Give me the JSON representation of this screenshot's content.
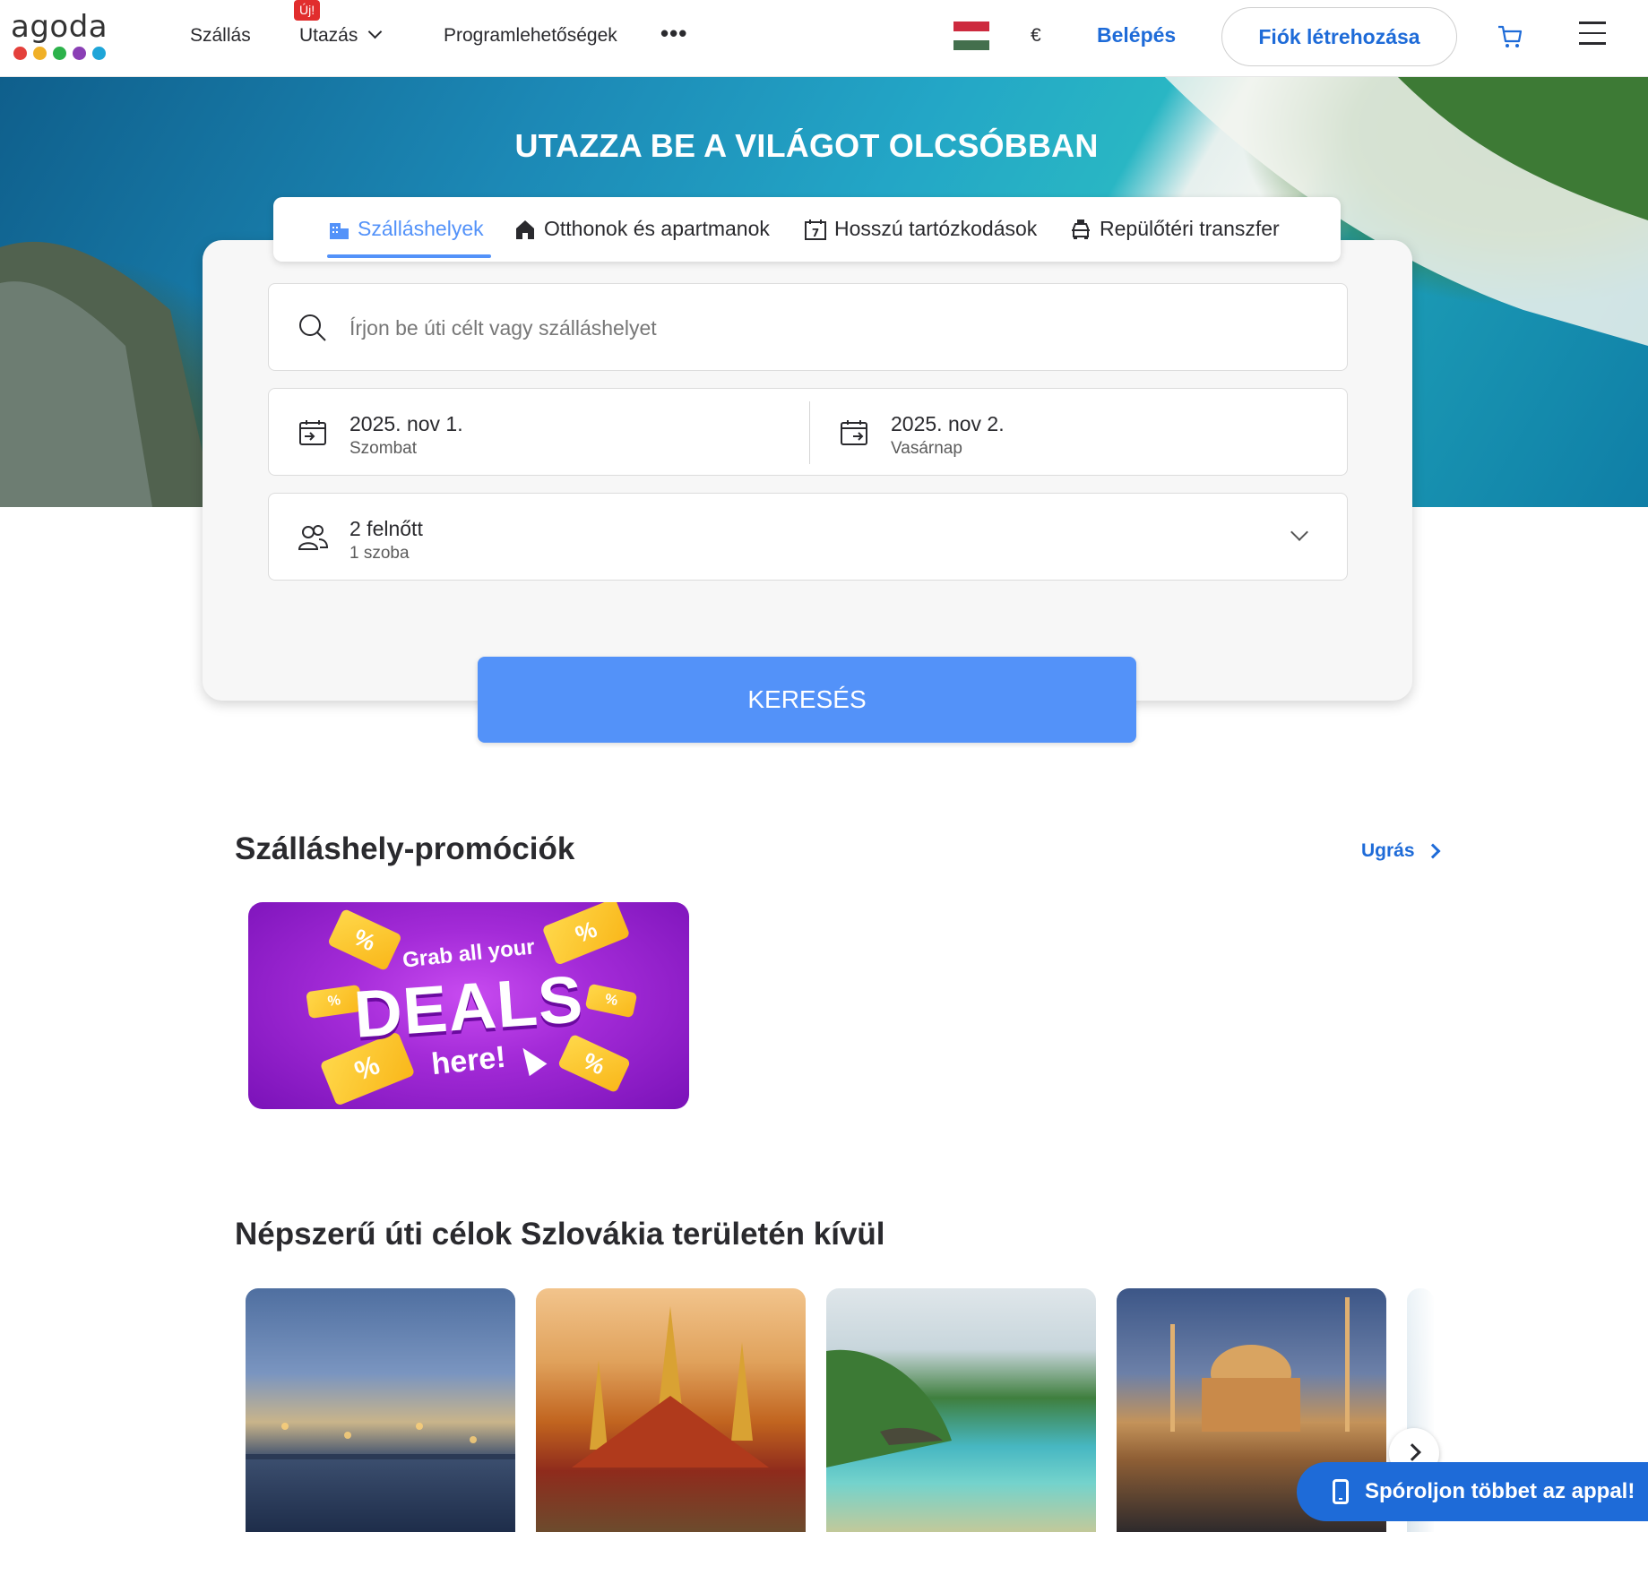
{
  "header": {
    "logo_text": "agoda",
    "logo_dot_colors": [
      "#e4403b",
      "#f0b027",
      "#2cb24b",
      "#8a3fb5",
      "#1ea5d8"
    ],
    "nav": {
      "accommodation": "Szállás",
      "travel": "Utazás",
      "travel_badge": "Új!",
      "activities": "Programlehetőségek",
      "more": "•••"
    },
    "flag": "hungary-flag",
    "currency": "€",
    "login": "Belépés",
    "signup": "Fiók létrehozása"
  },
  "hero": {
    "title": "UTAZZA BE A VILÁGOT OLCSÓBBAN"
  },
  "search": {
    "tabs": [
      {
        "label": "Szálláshelyek",
        "icon": "hotel-icon",
        "active": true
      },
      {
        "label": "Otthonok és apartmanok",
        "icon": "home-icon",
        "active": false
      },
      {
        "label": "Hosszú tartózkodások",
        "icon": "calendar-seven-icon",
        "active": false
      },
      {
        "label": "Repülőtéri transzfer",
        "icon": "car-icon",
        "active": false
      }
    ],
    "destination_placeholder": "Írjon be úti célt vagy szálláshelyet",
    "checkin": {
      "date": "2025. nov 1.",
      "day": "Szombat"
    },
    "checkout": {
      "date": "2025. nov 2.",
      "day": "Vasárnap"
    },
    "guests": {
      "adults": "2 felnőtt",
      "rooms": "1 szoba"
    },
    "button": "KERESÉS"
  },
  "promotions": {
    "title": "Szálláshely-promóciók",
    "jump": "Ugrás",
    "banner": {
      "line1": "Grab all your",
      "line2": "DEALS",
      "line3": "here!"
    }
  },
  "destinations": {
    "title": "Népszerű úti célok Szlovákia területén kívül",
    "cards": [
      "budapest",
      "bangkok",
      "phuket",
      "istanbul"
    ]
  },
  "app_banner": "Spóroljon többet az appal!",
  "colors": {
    "brand_blue": "#1e6bd8",
    "search_blue": "#5392f9",
    "badge_red": "#e12d2d"
  }
}
